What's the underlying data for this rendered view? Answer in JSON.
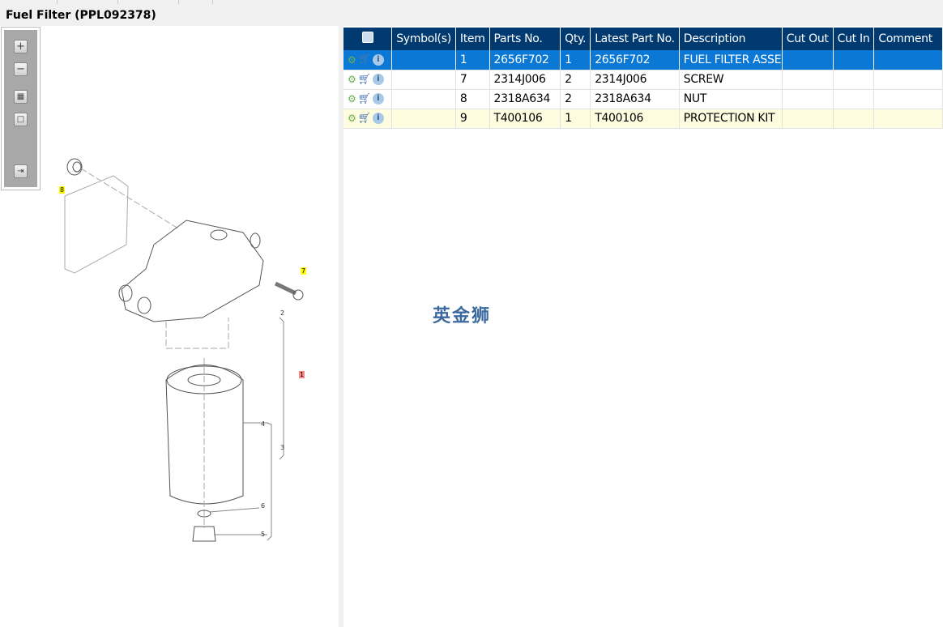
{
  "title": "Fuel Filter (PPL092378)",
  "toolbar": [
    "zoom-in",
    "zoom-out",
    "fit-all",
    "fit-window",
    "export"
  ],
  "diagram": {
    "callouts": [
      {
        "label": "8",
        "style": "yellow"
      },
      {
        "label": "7",
        "style": "yellow"
      },
      {
        "label": "1",
        "style": "red"
      }
    ],
    "numbers": [
      "2",
      "3",
      "4",
      "5",
      "6"
    ]
  },
  "watermark": "英金狮",
  "table": {
    "headers": [
      "",
      "Symbol(s)",
      "Item",
      "Parts No.",
      "Qty.",
      "Latest Part No.",
      "Description",
      "Cut Out",
      "Cut In",
      "Comment"
    ],
    "rows": [
      {
        "symbol": "",
        "item": "1",
        "parts_no": "2656F702",
        "qty": "1",
        "latest": "2656F702",
        "description": "FUEL FILTER ASSEMBLY",
        "cut_out": "",
        "cut_in": "",
        "comment": ""
      },
      {
        "symbol": "",
        "item": "7",
        "parts_no": "2314J006",
        "qty": "2",
        "latest": "2314J006",
        "description": "SCREW",
        "cut_out": "",
        "cut_in": "",
        "comment": ""
      },
      {
        "symbol": "",
        "item": "8",
        "parts_no": "2318A634",
        "qty": "2",
        "latest": "2318A634",
        "description": "NUT",
        "cut_out": "",
        "cut_in": "",
        "comment": ""
      },
      {
        "symbol": "",
        "item": "9",
        "parts_no": "T400106",
        "qty": "1",
        "latest": "T400106",
        "description": "PROTECTION KIT",
        "cut_out": "",
        "cut_in": "",
        "comment": ""
      }
    ]
  },
  "colors": {
    "header": "#003a70",
    "selected": "#0a78d4",
    "highlight": "#fefde0"
  }
}
